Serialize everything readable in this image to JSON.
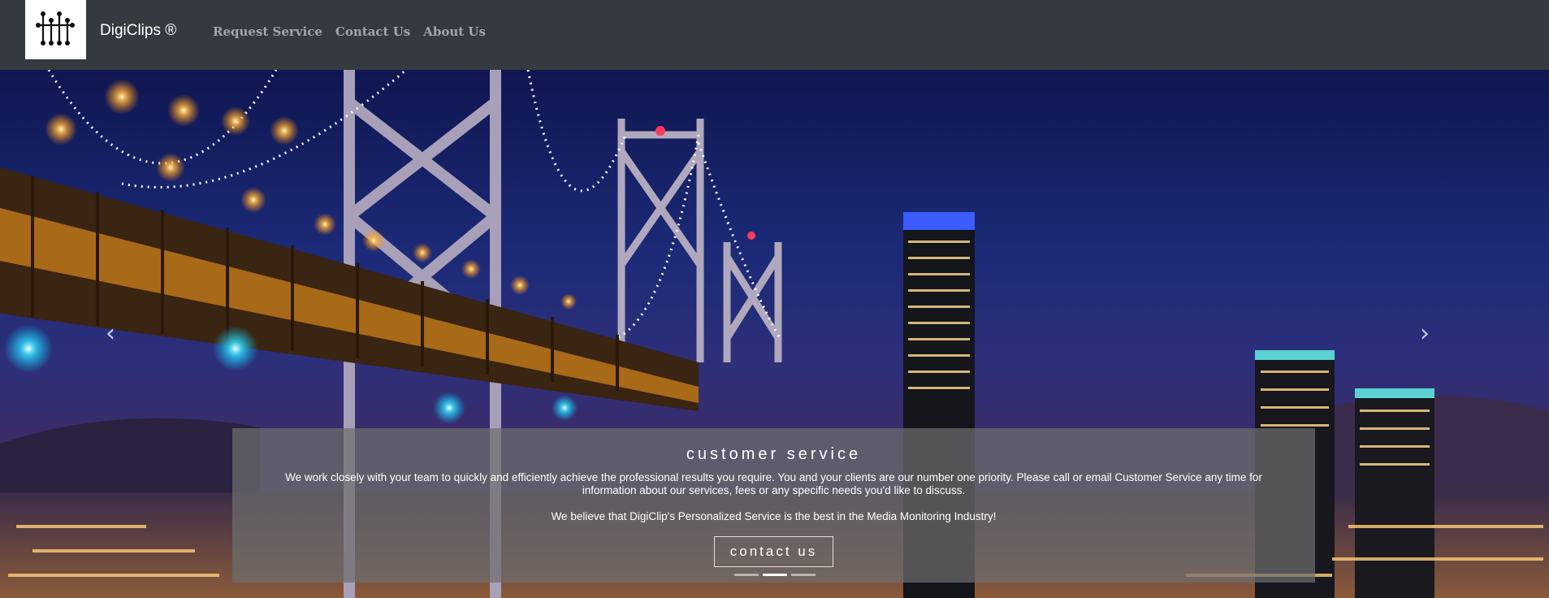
{
  "brand": {
    "name": "DigiClips ®",
    "logo_icon": "circuit-logo-icon"
  },
  "nav": {
    "links": [
      {
        "label": "Request Service"
      },
      {
        "label": "Contact Us"
      },
      {
        "label": "About Us"
      }
    ]
  },
  "hero": {
    "prev_icon": "‹",
    "next_icon": "›",
    "caption": {
      "title": "customer service",
      "body": "We work closely with your team to quickly and efficiently achieve the professional results you require. You and your clients are our number one priority. Please call or email Customer Service any time for information about our services, fees or any specific needs you'd like to discuss.",
      "body2": "We believe that DigiClip's Personalized Service is the best in the Media Monitoring Industry!",
      "button_label": "contact us"
    },
    "indicators": {
      "count": 3,
      "active": 1
    }
  },
  "colors": {
    "navbar": "#343a40",
    "nav_link": "#a3a7ab",
    "caption_bg": "#6e6e6e"
  }
}
